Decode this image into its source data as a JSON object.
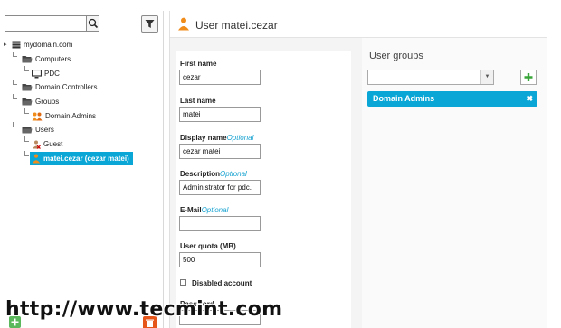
{
  "search": {
    "value": "",
    "placeholder": ""
  },
  "tree": {
    "root": "mydomain.com",
    "computers": "Computers",
    "pdc": "PDC",
    "domain_controllers": "Domain Controllers",
    "groups": "Groups",
    "domain_admins": "Domain Admins",
    "users": "Users",
    "guest": "Guest",
    "selected_user": "matei.cezar (cezar matei)"
  },
  "header": {
    "title": "User matei.cezar"
  },
  "form": {
    "first_name_label": "First name",
    "first_name_value": "cezar",
    "last_name_label": "Last name",
    "last_name_value": "matei",
    "display_name_label": "Display name",
    "display_name_optional": "Optional",
    "display_name_value": "cezar matei",
    "description_label": "Description",
    "description_optional": "Optional",
    "description_value": "Administrator for pdc.",
    "email_label": "E-Mail",
    "email_optional": "Optional",
    "email_value": "",
    "quota_label": "User quota (MB)",
    "quota_value": "500",
    "disabled_label": "Disabled account",
    "password_label": "Password"
  },
  "groups_panel": {
    "title": "User groups",
    "select_value": "",
    "chips": [
      "Domain Admins"
    ]
  },
  "watermark": "http://www.tecmint.com",
  "colors": {
    "accent": "#0aa6d6",
    "user_icon": "#f08c1a",
    "add_green": "#5cb85c",
    "delete_orange": "#e6561b"
  }
}
